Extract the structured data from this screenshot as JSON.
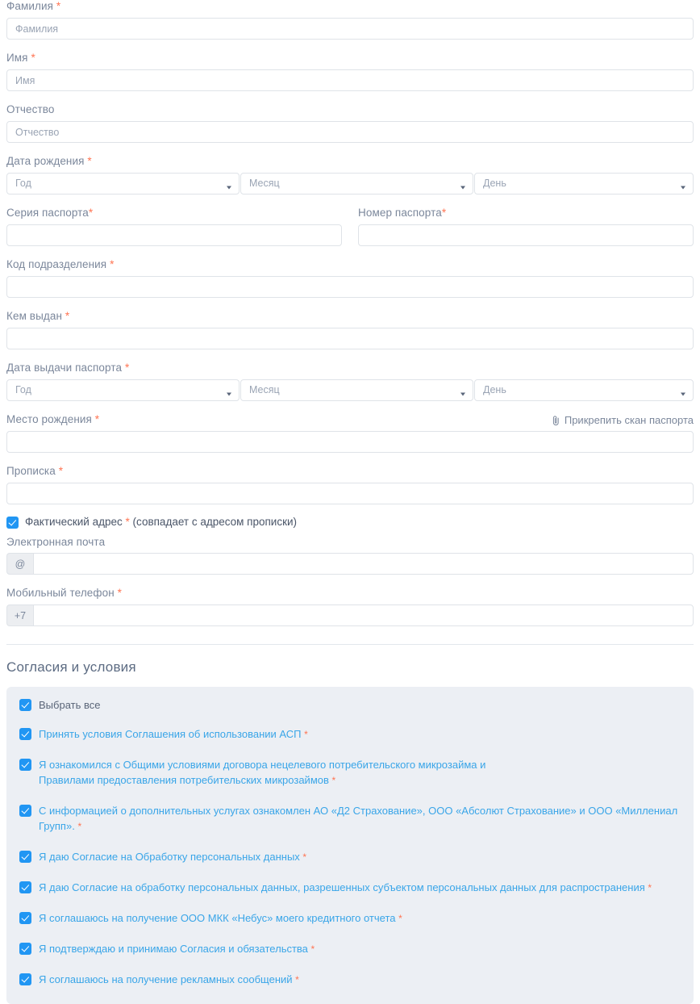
{
  "form": {
    "fields": {
      "surname": {
        "label": "Фамилия",
        "required": true,
        "placeholder": "Фамилия"
      },
      "name": {
        "label": "Имя",
        "required": true,
        "placeholder": "Имя"
      },
      "patronymic": {
        "label": "Отчество",
        "required": false,
        "placeholder": "Отчество"
      },
      "birth_date": {
        "label": "Дата рождения",
        "required": true
      },
      "passport_series": {
        "label": "Серия паспорта",
        "required": true,
        "placeholder": ""
      },
      "passport_number": {
        "label": "Номер паспорта",
        "required": true,
        "placeholder": ""
      },
      "division_code": {
        "label": "Код подразделения",
        "required": true,
        "placeholder": ""
      },
      "issued_by": {
        "label": "Кем выдан",
        "required": true,
        "placeholder": ""
      },
      "issue_date": {
        "label": "Дата выдачи паспорта",
        "required": true
      },
      "birth_place": {
        "label": "Место рождения",
        "required": true,
        "placeholder": ""
      },
      "registration": {
        "label": "Прописка",
        "required": true,
        "placeholder": ""
      },
      "email": {
        "label": "Электронная почта",
        "required": false,
        "placeholder": "",
        "prefix": "@"
      },
      "phone": {
        "label": "Мобильный телефон",
        "required": true,
        "placeholder": "",
        "prefix": "+7"
      }
    },
    "date_selects": {
      "year": "Год",
      "month": "Месяц",
      "day": "День"
    },
    "attach_scan": {
      "label": "Прикрепить скан паспорта",
      "icon": "paperclip-icon"
    },
    "actual_address_checkbox": {
      "label": "Фактический адрес",
      "suffix": "(совпадает с адресом прописки)",
      "required": true,
      "checked": true
    }
  },
  "consents": {
    "title": "Согласия и условия",
    "select_all": {
      "label": "Выбрать все",
      "checked": true,
      "required": false
    },
    "items": [
      {
        "label": "Принять условия Соглашения об использовании АСП",
        "required": true,
        "checked": true
      },
      {
        "label": "Я ознакомился с Общими условиями договора нецелевого потребительского микрозайма и Правилами предоставления потребительских микрозаймов",
        "required": true,
        "checked": true
      },
      {
        "label": "С информацией о дополнительных услугах ознакомлен АО «Д2 Страхование», ООО «Абсолют Страхование» и ООО «Миллениал Групп».",
        "required": true,
        "checked": true
      },
      {
        "label": "Я даю Согласие на Обработку персональных данных",
        "required": true,
        "checked": true
      },
      {
        "label": "Я даю Согласие на обработку персональных данных, разрешенных субъектом персональных данных для распространения",
        "required": true,
        "checked": true
      },
      {
        "label": "Я соглашаюсь на получение ООО МКК «Небус» моего кредитного отчета",
        "required": true,
        "checked": true
      },
      {
        "label": "Я подтверждаю и принимаю Согласия и обязательства",
        "required": true,
        "checked": true
      },
      {
        "label": "Я соглашаюсь на получение рекламных сообщений",
        "required": true,
        "checked": true
      }
    ]
  },
  "colors": {
    "accent_blue": "#2196f3",
    "link_blue": "#39a5e8",
    "required_asterisk": "#ff7452",
    "label_gray": "#7b879b",
    "border_gray": "#dfe3e8",
    "panel_bg": "#eceff4"
  }
}
